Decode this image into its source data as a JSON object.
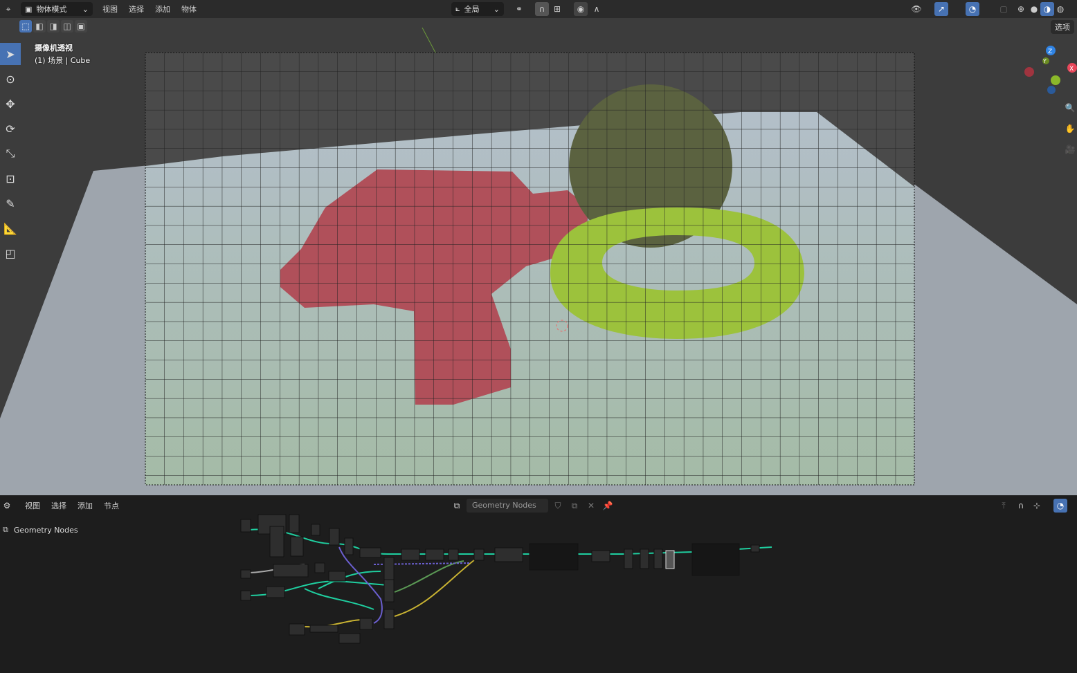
{
  "topbar": {
    "mode": "物体模式",
    "menus": [
      "视图",
      "选择",
      "添加",
      "物体"
    ],
    "transform_orientation": "全局",
    "options_label": "选项"
  },
  "viewport": {
    "view_name": "摄像机透视",
    "object_info": "(1) 场景 | Cube",
    "gizmo_axes": [
      "X",
      "Y",
      "Z"
    ]
  },
  "node_editor": {
    "menus": [
      "视图",
      "选择",
      "添加",
      "节点"
    ],
    "node_group": "Geometry Nodes",
    "breadcrumb": "Geometry Nodes"
  },
  "colors": {
    "accent": "#4772b3",
    "monkey": "#b0505a",
    "torus": "#9cc23c",
    "plane": "#a9b4bd",
    "link_geometry": "#1fcfa0",
    "link_float": "#a0a0a0",
    "link_vector": "#6b5fd0",
    "link_yellow": "#c9b332"
  }
}
